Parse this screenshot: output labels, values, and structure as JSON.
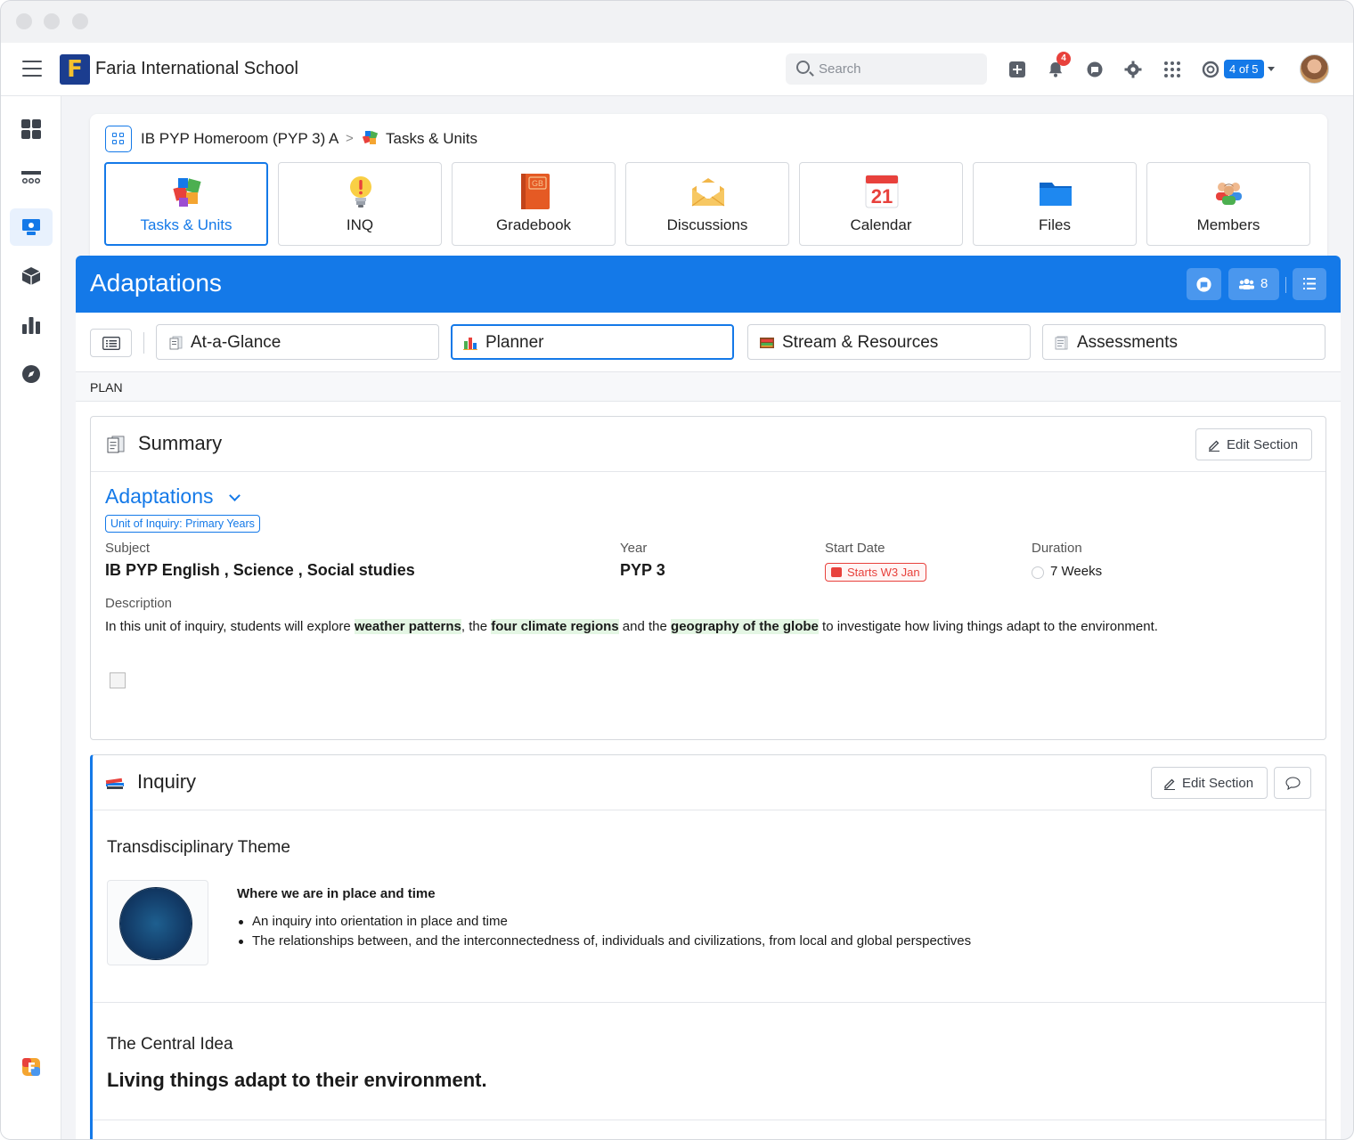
{
  "topbar": {
    "school_name": "Faria International School",
    "logo_letter": "F",
    "search_placeholder": "Search",
    "notification_count": "4",
    "year_indicator": "4 of 5"
  },
  "breadcrumb": {
    "class_name": "IB PYP Homeroom (PYP 3) A",
    "separator": ">",
    "current": "Tasks & Units"
  },
  "apps": [
    {
      "label": "Tasks & Units",
      "icon": "puzzle-icon",
      "active": true
    },
    {
      "label": "INQ",
      "icon": "lightbulb-icon"
    },
    {
      "label": "Gradebook",
      "icon": "gradebook-icon",
      "icon_text": "GB"
    },
    {
      "label": "Discussions",
      "icon": "envelope-icon"
    },
    {
      "label": "Calendar",
      "icon": "calendar-icon",
      "icon_text": "21"
    },
    {
      "label": "Files",
      "icon": "folder-icon"
    },
    {
      "label": "Members",
      "icon": "members-icon"
    }
  ],
  "unit": {
    "title": "Adaptations",
    "member_count": "8"
  },
  "tabs": [
    {
      "label": "At-a-Glance",
      "icon": "glance-icon"
    },
    {
      "label": "Planner",
      "icon": "planner-icon",
      "active": true
    },
    {
      "label": "Stream & Resources",
      "icon": "stream-icon"
    },
    {
      "label": "Assessments",
      "icon": "assessments-icon"
    }
  ],
  "plan_label": "PLAN",
  "summary": {
    "section_title": "Summary",
    "edit_label": "Edit Section",
    "unit_title": "Adaptations",
    "unit_type": "Unit of Inquiry: Primary Years",
    "subject_label": "Subject",
    "subject_value": "IB PYP English , Science , Social studies",
    "year_label": "Year",
    "year_value": "PYP 3",
    "start_label": "Start Date",
    "start_value": "Starts W3 Jan",
    "duration_label": "Duration",
    "duration_value": "7 Weeks",
    "description_label": "Description",
    "description": {
      "p1": "In this unit of inquiry, students will explore ",
      "h1": "weather patterns",
      "p2": ", the ",
      "h2": "four climate regions",
      "p3": " and the ",
      "h3": "geography of the globe",
      "p4": " to investigate how living things adapt to the environment."
    }
  },
  "inquiry": {
    "section_title": "Inquiry",
    "edit_label": "Edit Section",
    "theme_heading": "Transdisciplinary Theme",
    "theme_title": "Where we are in place and time",
    "theme_points": [
      "An inquiry into orientation in place and time",
      "The relationships between, and the interconnectedness of, individuals and civilizations, from local and global perspectives"
    ],
    "central_heading": "The Central Idea",
    "central_idea": "Living things adapt to their environment."
  },
  "colors": {
    "accent": "#1479e8",
    "highlight": "#e4f6e4",
    "danger": "#e8413c"
  }
}
